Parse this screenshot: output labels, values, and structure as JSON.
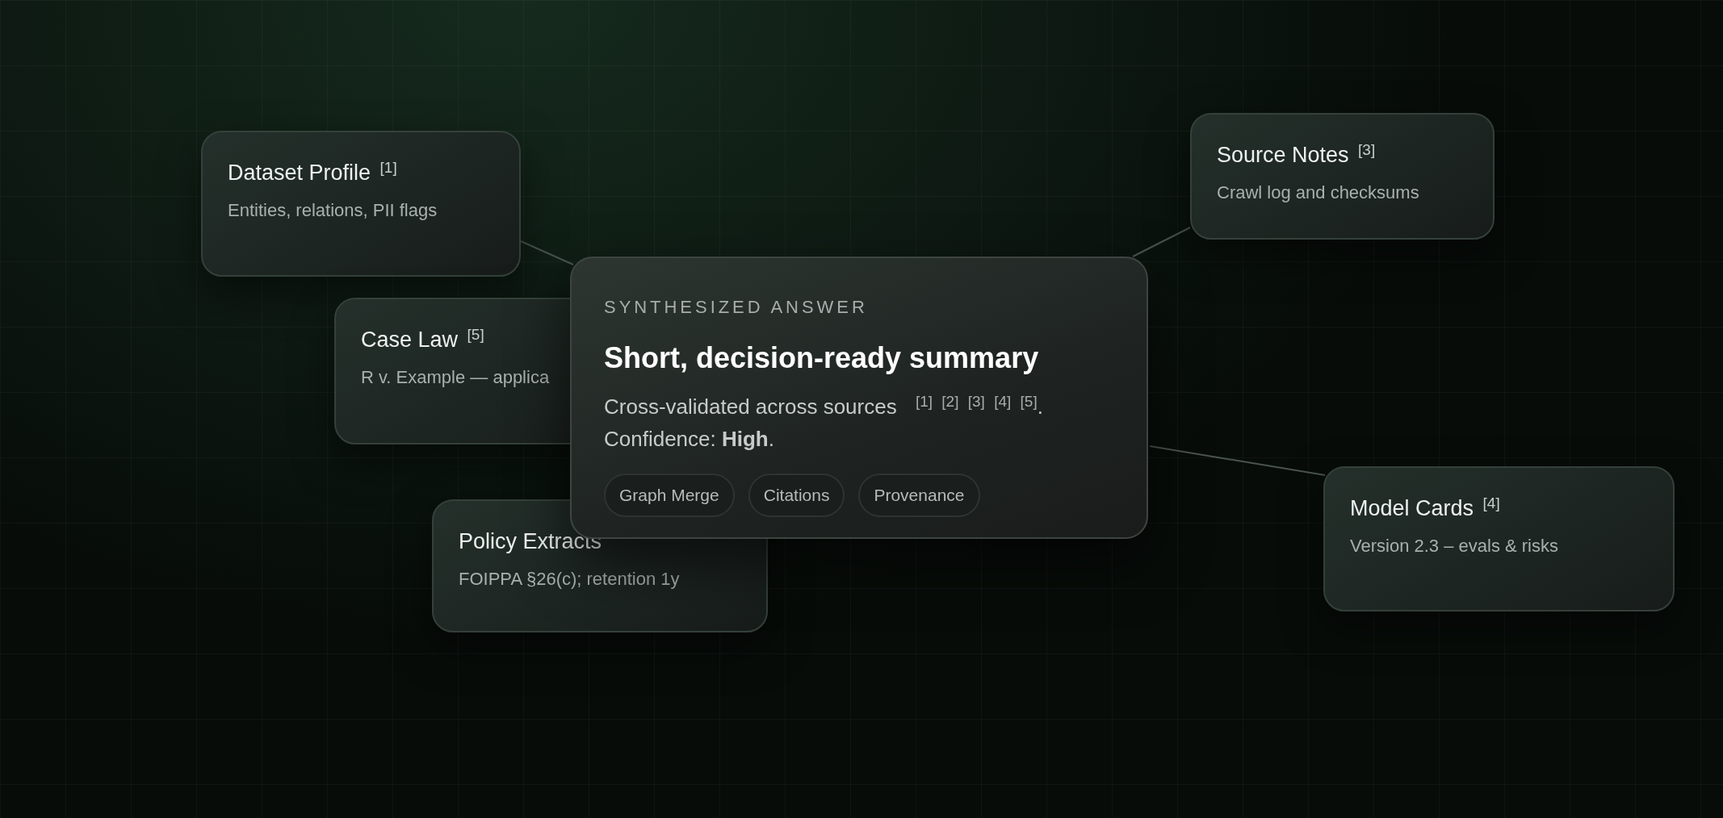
{
  "sources": [
    {
      "title": "Dataset Profile $^{[1]}$",
      "description": "Entities, relations, PII flags"
    },
    {
      "title": "Source Notes $^{[3]}$",
      "description": "Crawl log and checksums"
    },
    {
      "title": "Case Law $^{[5]}$",
      "description": "R v. Example — applica"
    },
    {
      "title": "Policy Extracts",
      "description": "FOIPPA §26(c); retention 1y"
    },
    {
      "title": "Model Cards $^{[4]}$",
      "description": "Version 2.3 – evals & risks"
    }
  ],
  "answer": {
    "eyebrow": "SYNTHESIZED ANSWER",
    "heading": "Short, decision-ready summary",
    "lines": [
      "Cross-validated across sources $^{[1] [2] [3] [4] [5]}$.",
      "Confidence: **High**."
    ],
    "tags": [
      "Graph Merge",
      "Citations",
      "Provenance"
    ]
  }
}
